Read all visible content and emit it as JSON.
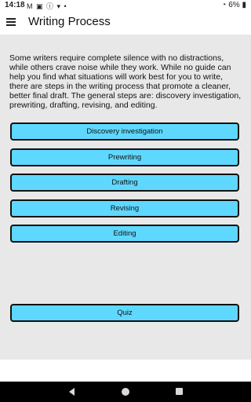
{
  "status_bar": {
    "time": "14:18",
    "left_icons": "M ▣ ⓘ ▾ •",
    "right_text": "6%"
  },
  "app_bar": {
    "title": "Writing Process"
  },
  "intro_text": "Some writers require complete silence with no distractions, while others crave noise while they work. While no guide can help you find what situations will work best for you to write, there are steps in the writing process that promote a cleaner, better final draft. The general steps are: discovery investigation, prewriting, drafting, revising, and editing.",
  "buttons": [
    {
      "label": "Discovery investigation"
    },
    {
      "label": "Prewriting"
    },
    {
      "label": "Drafting"
    },
    {
      "label": "Revising"
    },
    {
      "label": "Editing"
    }
  ],
  "quiz_button": {
    "label": "Quiz"
  },
  "colors": {
    "button_fill": "#5fd8ff",
    "button_border": "#111111",
    "background": "#e8e8e8"
  }
}
